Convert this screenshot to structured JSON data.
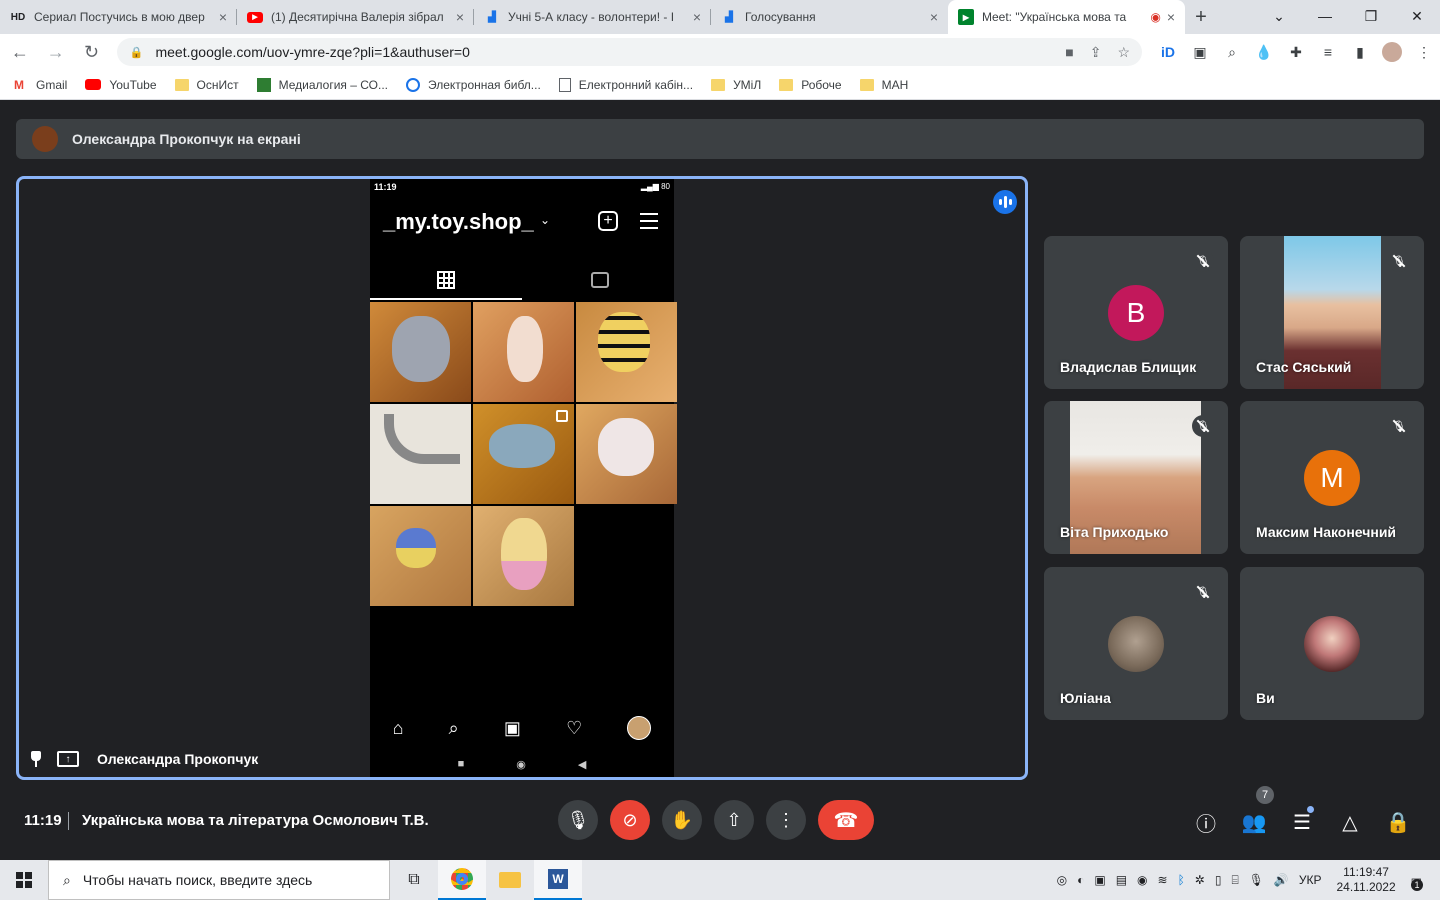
{
  "browser": {
    "tabs": [
      {
        "icon": "hd-icon",
        "icon_text": "HD",
        "title": "Сериал Постучись в мою двер"
      },
      {
        "icon": "youtube-icon",
        "title": "(1) Десятирічна Валерія зібрал"
      },
      {
        "icon": "chart-icon",
        "title": "Учні 5-А класу - волонтери! - I"
      },
      {
        "icon": "chart-icon",
        "title": "Голосування"
      },
      {
        "icon": "meet-icon",
        "title": "Meet: \"Українська мова та"
      }
    ],
    "url": "meet.google.com/uov-ymre-zqe?pli=1&authuser=0",
    "bookmarks": [
      {
        "icon": "gmail-icon",
        "label": "Gmail"
      },
      {
        "icon": "youtube-icon",
        "label": "YouTube"
      },
      {
        "icon": "folder-icon",
        "label": "ОснИст"
      },
      {
        "icon": "site-icon",
        "label": "Медиалогия – СО..."
      },
      {
        "icon": "site-icon",
        "label": "Электронная библ..."
      },
      {
        "icon": "doc-icon",
        "label": "Електронний кабін..."
      },
      {
        "icon": "folder-icon",
        "label": "УМіЛ"
      },
      {
        "icon": "folder-icon",
        "label": "Робоче"
      },
      {
        "icon": "folder-icon",
        "label": "МАН"
      }
    ]
  },
  "meet": {
    "presenting_banner": "Олександра Прокопчук на екрані",
    "stage_name": "Олександра Прокопчук",
    "phone": {
      "status_time": "11:19",
      "battery": "80",
      "shop_name": "_my.toy.shop_"
    },
    "participants": [
      {
        "name": "Владислав Блищик",
        "letter": "В",
        "color": "#c2185b"
      },
      {
        "name": "Стас Сяський"
      },
      {
        "name": "Віта Приходько"
      },
      {
        "name": "Максим Наконечний",
        "letter": "М",
        "color": "#e8710a"
      },
      {
        "name": "Юліана"
      },
      {
        "name": "Ви"
      }
    ],
    "clock": "11:19",
    "meeting_title": "Українська мова та література Осмолович Т.В.",
    "people_count": "7"
  },
  "taskbar": {
    "search_placeholder": "Чтобы начать поиск, введите здесь",
    "language": "УКР",
    "time": "11:19:47",
    "date": "24.11.2022",
    "notifications": "1"
  },
  "colors": {
    "accent": "#8ab4f8",
    "danger": "#ea4335",
    "meet_bg": "#202124"
  }
}
